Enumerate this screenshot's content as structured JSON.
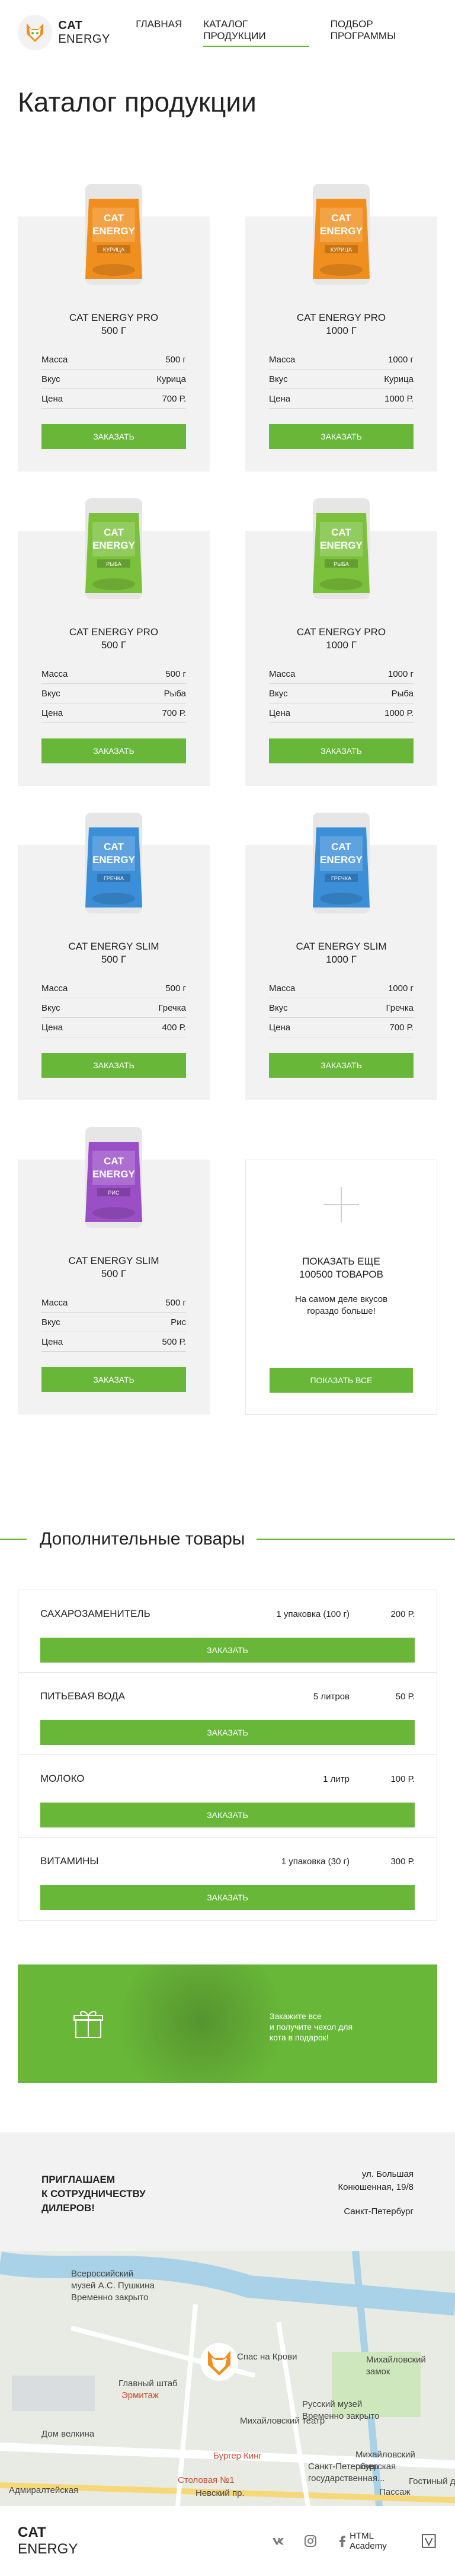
{
  "header": {
    "logo_bold": "CAT",
    "logo_light": " ENERGY",
    "nav": [
      "ГЛАВНАЯ",
      "КАТАЛОГ ПРОДУКЦИИ",
      "ПОДБОР ПРОГРАММЫ"
    ]
  },
  "page_title": "Каталог продукции",
  "products": [
    {
      "title1": "CAT ENERGY PRO",
      "title2": "500 Г",
      "flavor_label": "КУРИЦА",
      "color": "#f08f1e",
      "rows": [
        [
          "Масса",
          "500 г"
        ],
        [
          "Вкус",
          "Курица"
        ],
        [
          "Цена",
          "700 Р."
        ]
      ],
      "button": "ЗАКАЗАТЬ"
    },
    {
      "title1": "CAT ENERGY PRO",
      "title2": "1000 Г",
      "flavor_label": "КУРИЦА",
      "color": "#f08f1e",
      "rows": [
        [
          "Масса",
          "1000 г"
        ],
        [
          "Вкус",
          "Курица"
        ],
        [
          "Цена",
          "1000 Р."
        ]
      ],
      "button": "ЗАКАЗАТЬ"
    },
    {
      "title1": "CAT ENERGY PRO",
      "title2": "500 Г",
      "flavor_label": "РЫБА",
      "color": "#7cc13b",
      "rows": [
        [
          "Масса",
          "500 г"
        ],
        [
          "Вкус",
          "Рыба"
        ],
        [
          "Цена",
          "700 Р."
        ]
      ],
      "button": "ЗАКАЗАТЬ"
    },
    {
      "title1": "CAT ENERGY PRO",
      "title2": "1000 Г",
      "flavor_label": "РЫБА",
      "color": "#7cc13b",
      "rows": [
        [
          "Масса",
          "1000 г"
        ],
        [
          "Вкус",
          "Рыба"
        ],
        [
          "Цена",
          "1000 Р."
        ]
      ],
      "button": "ЗАКАЗАТЬ"
    },
    {
      "title1": "CAT ENERGY SLIM",
      "title2": "500 Г",
      "flavor_label": "ГРЕЧКА",
      "color": "#3b8fd8",
      "rows": [
        [
          "Масса",
          "500 г"
        ],
        [
          "Вкус",
          "Гречка"
        ],
        [
          "Цена",
          "400 Р."
        ]
      ],
      "button": "ЗАКАЗАТЬ"
    },
    {
      "title1": "CAT ENERGY SLIM",
      "title2": "1000 Г",
      "flavor_label": "ГРЕЧКА",
      "color": "#3b8fd8",
      "rows": [
        [
          "Масса",
          "1000 г"
        ],
        [
          "Вкус",
          "Гречка"
        ],
        [
          "Цена",
          "700 Р."
        ]
      ],
      "button": "ЗАКАЗАТЬ"
    },
    {
      "title1": "CAT ENERGY SLIM",
      "title2": "500 Г",
      "flavor_label": "РИС",
      "color": "#9a4fc6",
      "rows": [
        [
          "Масса",
          "500 г"
        ],
        [
          "Вкус",
          "Рис"
        ],
        [
          "Цена",
          "500 Р."
        ]
      ],
      "button": "ЗАКАЗАТЬ"
    }
  ],
  "more": {
    "title1": "ПОКАЗАТЬ ЕЩЕ",
    "title2": "100500 ТОВАРОВ",
    "text1": "На самом деле вкусов",
    "text2": "гораздо больше!",
    "button": "ПОКАЗАТЬ ВСЕ"
  },
  "extra": {
    "title": "Дополнительные товары",
    "items": [
      {
        "name": "САХАРОЗАМЕНИТЕЛЬ",
        "qty": "1 упаковка (100 г)",
        "price": "200 Р.",
        "button": "ЗАКАЗАТЬ"
      },
      {
        "name": "ПИТЬЕВАЯ ВОДА",
        "qty": "5 литров",
        "price": "50 Р.",
        "button": "ЗАКАЗАТЬ"
      },
      {
        "name": "МОЛОКО",
        "qty": "1 литр",
        "price": "100 Р.",
        "button": "ЗАКАЗАТЬ"
      },
      {
        "name": "ВИТАМИНЫ",
        "qty": "1 упаковка (30 г)",
        "price": "300 Р.",
        "button": "ЗАКАЗАТЬ"
      }
    ]
  },
  "promo": {
    "line1": "Закажите все",
    "line2": "и получите чехол для",
    "line3": "кота в подарок!"
  },
  "dealers": {
    "line1": "ПРИГЛАШАЕМ",
    "line2": "К СОТРУДНИЧЕСТВУ",
    "line3": "ДИЛЕРОВ!",
    "addr1": "ул. Большая",
    "addr2": "Конюшенная, 19/8",
    "city": "Санкт-Петербург"
  },
  "map": {
    "labels": [
      "Всероссийский",
      "музей А.С. Пушкина",
      "Временно закрыто",
      "Спас на Крови",
      "Михайловский",
      "замок",
      "Главный штаб",
      "Эрмитаж",
      "Русский музей",
      "Временно закрыто",
      "Михайловский театр",
      "Михайловский",
      "сквер",
      "Дом велкина",
      "Бургер Кинг",
      "Санкт-Петербургская",
      "государственная...",
      "Столовая №1",
      "Адмиралтейская",
      "Невский пр.",
      "Пассаж",
      "Гостиный двор"
    ]
  },
  "footer": {
    "logo_bold": "CAT",
    "logo_light": " ENERGY",
    "academy": "HTML Academy"
  },
  "colors": {
    "accent": "#68b738",
    "card_bg": "#f2f2f2"
  },
  "icons": [
    "vk-icon",
    "instagram-icon",
    "facebook-icon",
    "gift-icon",
    "plus-icon",
    "map-pin-icon",
    "academy-icon"
  ]
}
